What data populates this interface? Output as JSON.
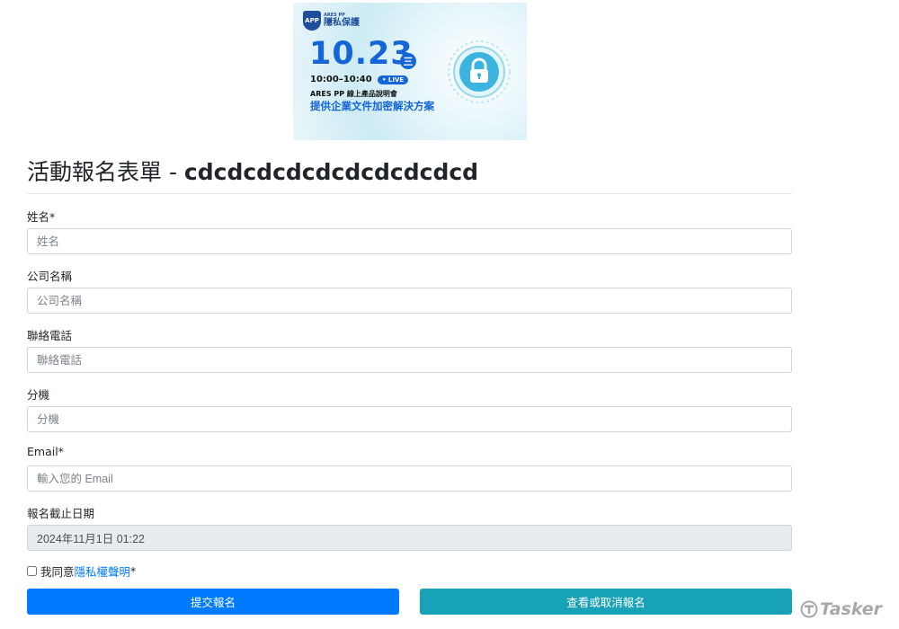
{
  "banner": {
    "brand_small": "ARES PP",
    "brand_name": "隱私保護",
    "brand_badge": "APP",
    "date": "10.23",
    "weekday": "三",
    "time": "10:00–10:40",
    "live": "• LIVE",
    "subtitle": "ARES PP 線上產品說明會",
    "slogan": "提供企業文件加密解決方案",
    "colors": {
      "accent": "#1565d8"
    },
    "icon": "padlock-icon"
  },
  "form": {
    "title_prefix": "活動報名表單 - ",
    "title_code": "cdcdcdcdcdcdcdcdcdcd",
    "fields": {
      "name": {
        "label": "姓名*",
        "placeholder": "姓名",
        "value": ""
      },
      "company": {
        "label": "公司名稱",
        "placeholder": "公司名稱",
        "value": ""
      },
      "phone": {
        "label": "聯絡電話",
        "placeholder": "聯絡電話",
        "value": ""
      },
      "ext": {
        "label": "分機",
        "placeholder": "分機",
        "value": ""
      },
      "email": {
        "label": "Email*",
        "placeholder": "輸入您的 Email",
        "value": ""
      },
      "deadline": {
        "label": "報名截止日期",
        "value": "2024年11月1日 01:22"
      }
    },
    "agree": {
      "prefix": "我同意",
      "link": "隱私權聲明",
      "suffix": "*"
    },
    "buttons": {
      "submit": "提交報名",
      "view_cancel": "查看或取消報名"
    },
    "colors": {
      "primary": "#007bff",
      "info": "#17a2b8"
    }
  },
  "watermark": {
    "text": "Tasker",
    "icon": "tasker-logo-icon"
  }
}
